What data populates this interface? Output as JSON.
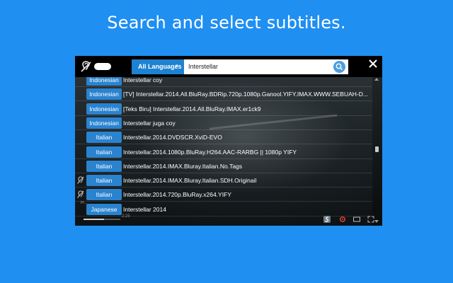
{
  "headline": "Search and select subtitles.",
  "toolbar": {
    "language_label": "All Languages",
    "search_value": "Interstellar"
  },
  "player": {
    "time_label": "2:25",
    "progress_fraction": 0.55,
    "side_label": "Pr..."
  },
  "subtitles": [
    {
      "language": "Indonesian",
      "name": "Interstellar coy",
      "hearing_impaired": false
    },
    {
      "language": "Indonesian",
      "name": "[TV] Interstellar.2014.All.BluRay.BDRip.720p.1080p.Ganool.YIFY.IMAX.WWW.SEBUAH-D...",
      "hearing_impaired": false
    },
    {
      "language": "Indonesian",
      "name": "[Teks Biru] Interstellar.2014.All.BluRay.IMAX.er1ck9",
      "hearing_impaired": false
    },
    {
      "language": "Indonesian",
      "name": "Interstellar juga coy",
      "hearing_impaired": false
    },
    {
      "language": "Italian",
      "name": "Interstellar.2014.DVDSCR.XviD-EVO",
      "hearing_impaired": false
    },
    {
      "language": "Italian",
      "name": "Interstellar.2014.1080p.BluRay.H264.AAC-RARBG || 1080p YIFY",
      "hearing_impaired": false
    },
    {
      "language": "Italian",
      "name": "Interstellar.2014.IMAX.Bluray.Italian.No.Tags",
      "hearing_impaired": false
    },
    {
      "language": "Italian",
      "name": "Interstellar.2014.IMAX.Bluray.Italian.SDH.Originail",
      "hearing_impaired": true
    },
    {
      "language": "Italian",
      "name": "Interstellar.2014.720p.BluRay.x264.YIFY",
      "hearing_impaired": true
    },
    {
      "language": "Japanese",
      "name": "Interstellar 2014",
      "hearing_impaired": false
    }
  ],
  "colors": {
    "background": "#1f8ff2",
    "badge": "#2a83cf",
    "language_button": "#1e82d2"
  },
  "icons": {
    "hearing": "hearing-impaired-icon",
    "search": "search-icon",
    "close": "close-icon"
  }
}
